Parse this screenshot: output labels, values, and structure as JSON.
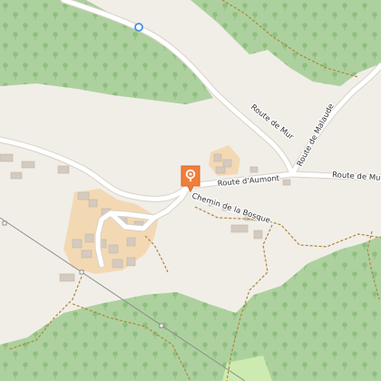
{
  "map": {
    "roads": {
      "route_de_mur_upper": "Route de Mur",
      "route_de_malaude": "Route de Malaude",
      "route_daumont": "Route d'Aumont",
      "route_de_mur_right": "Route de Mur",
      "chemin_de_la_bosque": "Chemin de la Bosque"
    },
    "marker": {
      "icon": "map-pin-icon",
      "color": "#f07f3c"
    },
    "colors": {
      "land": "#f1eee8",
      "forest": "#add19e",
      "settlement": "#f3d9b3",
      "road": "#ffffff",
      "track": "#b0843a",
      "powerline": "#888888",
      "building": "#d5cabf"
    }
  }
}
